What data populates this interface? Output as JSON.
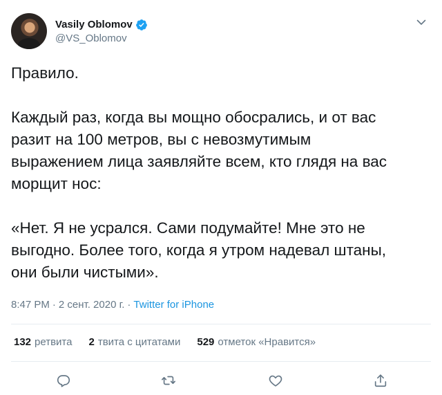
{
  "author": {
    "display_name": "Vasily Oblomov",
    "handle": "@VS_Oblomov",
    "verified_icon": "verified-badge-icon",
    "accent_color": "#1da1f2"
  },
  "tweet": {
    "text": "Правило.\n\nКаждый раз, когда вы мощно обосрались, и от вас\nразит на 100 метров, вы с невозмутимым\nвыражением лица заявляйте всем, кто глядя на вас\nморщит нос:\n\n«Нет. Я не усрался. Сами подумайте! Мне это не\nвыгодно. Более того, когда я утром надевал штаны,\nони были чистыми»."
  },
  "meta": {
    "time": "8:47 PM",
    "date": "2 сент. 2020 г.",
    "separator": "·",
    "source": "Twitter for iPhone"
  },
  "stats": {
    "retweets_count": "132",
    "retweets_label": "ретвита",
    "quotes_count": "2",
    "quotes_label": "твита с цитатами",
    "likes_count": "529",
    "likes_label": "отметок «Нравится»"
  },
  "actions": {
    "reply_icon": "reply-icon",
    "retweet_icon": "retweet-icon",
    "like_icon": "heart-icon",
    "share_icon": "share-icon",
    "icon_color": "#657786"
  }
}
